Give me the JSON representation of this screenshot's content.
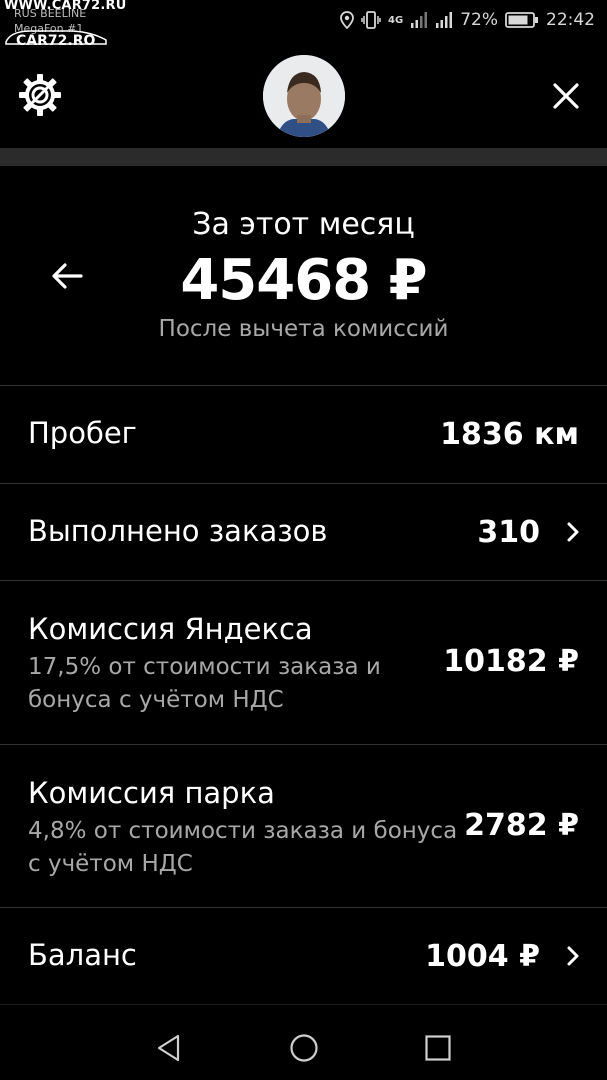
{
  "watermark": {
    "top": "WWW.CAR72.RU",
    "logo": "CAR72.RO"
  },
  "statusbar": {
    "operator_1": "RUS BEELINE",
    "operator_2": "MegaFon #1",
    "network": "4G",
    "battery": "72%",
    "time": "22:42"
  },
  "header": {
    "settings_icon": "gear-icon",
    "close_icon": "close-icon"
  },
  "summary": {
    "period": "За этот месяц",
    "total": "45468 ₽",
    "note": "После вычета комиссий"
  },
  "rows": [
    {
      "title": "Пробег",
      "value": "1836 км"
    },
    {
      "title": "Выполнено заказов",
      "value": "310"
    },
    {
      "title": "Комиссия Яндекса",
      "subtitle": "17,5% от стоимости заказа и бонуса с учётом НДС",
      "value": "10182 ₽"
    },
    {
      "title": "Комиссия парка",
      "subtitle": "4,8% от стоимости заказа и бонуса с учётом НДС",
      "value": "2782 ₽"
    },
    {
      "title": "Баланс",
      "value": "1004 ₽"
    }
  ]
}
